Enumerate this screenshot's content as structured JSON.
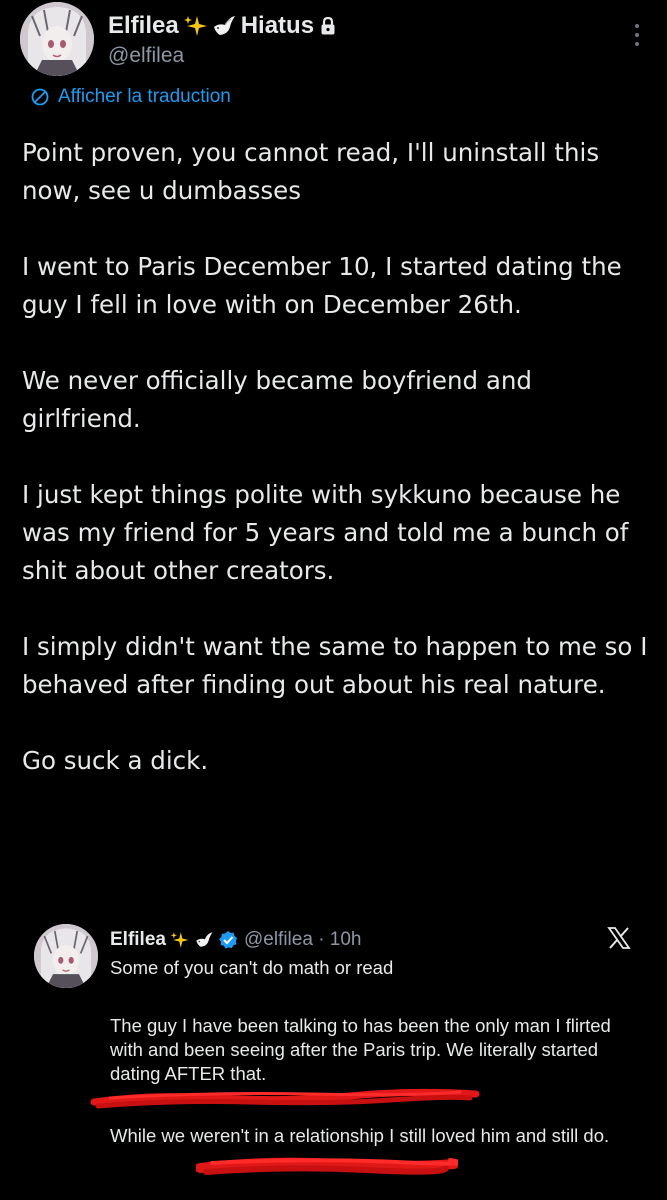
{
  "author": {
    "display_name": "Elfilea",
    "emoji_1": "sparkles-emoji",
    "emoji_2": "dove-emoji",
    "status": "Hiatus",
    "handle": "@elfilea"
  },
  "translate_link": "Afficher la traduction",
  "tweet": {
    "paragraphs": [
      "Point proven, you cannot read, I'll uninstall this now, see u dumbasses",
      "I went to Paris December 10, I started dating the guy I fell in love with on December 26th.",
      "We never officially became boyfriend and girlfriend.",
      "I just kept things polite with sykkuno because he was my friend for 5 years and told me a bunch of shit about other creators.",
      "I simply didn't want the same to happen to me so I behaved after finding out about his real nature.",
      "Go suck a dick."
    ]
  },
  "quoted_tweet": {
    "display_name": "Elfilea",
    "handle_time": "@elfilea · 10h",
    "lines": [
      "Some of you can't do math or read",
      "The guy I have been talking to has been the only man I flirted with and been seeing after the Paris trip.  We literally started dating AFTER that.",
      "While we weren't in a relationship I still loved him and still do."
    ]
  },
  "colors": {
    "background": "#000000",
    "text": "#e7e9ea",
    "secondary": "#8b98a5",
    "link": "#1d9bf0",
    "annotation_red": "#e01818"
  }
}
